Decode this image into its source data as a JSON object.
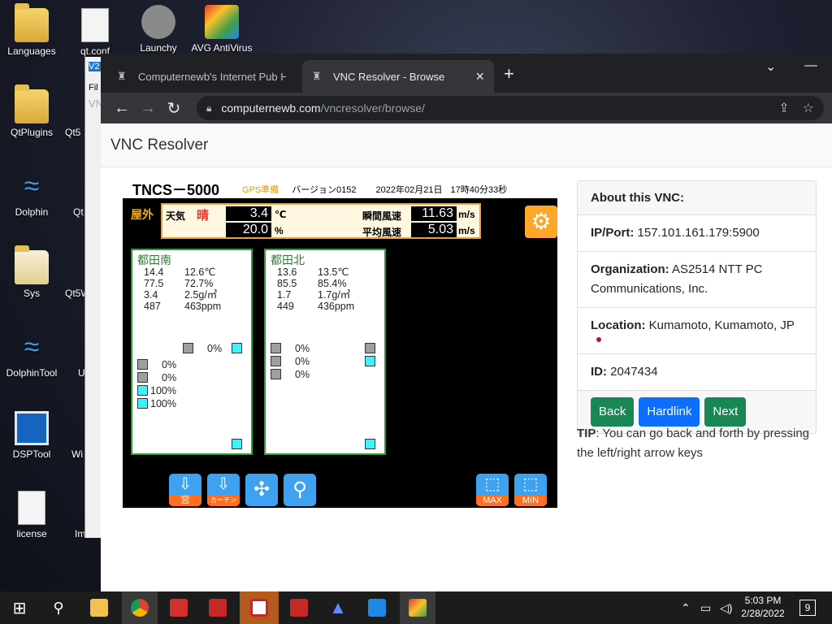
{
  "desktop": {
    "icons": [
      "Languages",
      "qt.conf",
      "Launchy",
      "AVG AntiVirus",
      "QtPlugins",
      "Qt5",
      "Dolphin",
      "Qt",
      "Sys",
      "Qt5W",
      "DolphinTool",
      "U",
      "DSPTool",
      "Wi",
      "license",
      "Im"
    ],
    "partial_window_labels": [
      "V2",
      "Fil",
      "VN"
    ]
  },
  "browser": {
    "tabs": [
      {
        "title": "Computernewb's Internet Pub Hu"
      },
      {
        "title": "VNC Resolver - Browse"
      }
    ],
    "url_host": "computernewb.com",
    "url_path": "/vncresolver/browse/"
  },
  "page": {
    "brand": "VNC Resolver",
    "vnc_screen": {
      "model": "TNCS－5000",
      "gps": "GPS準備",
      "version": "バージョン0152",
      "date": "2022年02月21日",
      "time": "17時40分33秒",
      "outdoor": "屋外",
      "weather_label": "天気",
      "weather_value": "晴",
      "temp": "3.4",
      "temp_unit": "℃",
      "humidity": "20.0",
      "humidity_unit": "%",
      "gust_label": "瞬間風速",
      "gust": "11.63",
      "avg_label": "平均風速",
      "avg": "5.03",
      "wind_unit": "m/s",
      "zones": [
        {
          "name": "都田南",
          "rows": [
            [
              "14.4",
              "12.6℃"
            ],
            [
              "77.5",
              "72.7%"
            ],
            [
              "3.4",
              "2.5g/㎥"
            ],
            [
              "487",
              "463ppm"
            ]
          ],
          "top_pct": "0%",
          "side_pcts": [
            "0%",
            "0%",
            "100%",
            "100%"
          ]
        },
        {
          "name": "都田北",
          "rows": [
            [
              "13.6",
              "13.5℃"
            ],
            [
              "85.5",
              "85.4%"
            ],
            [
              "1.7",
              "1.7g/㎥"
            ],
            [
              "449",
              "436ppm"
            ]
          ],
          "side_pcts": [
            "0%",
            "0%",
            "0%"
          ]
        }
      ],
      "bottom_buttons": [
        "窓",
        "カーテン",
        "MAX",
        "MIN"
      ]
    },
    "card": {
      "header": "About this VNC:",
      "ip_label": "IP/Port:",
      "ip_value": "157.101.161.179:5900",
      "org_label": "Organization:",
      "org_value": "AS2514 NTT PC Communications, Inc.",
      "loc_label": "Location:",
      "loc_value": "Kumamoto, Kumamoto, JP",
      "id_label": "ID:",
      "id_value": "2047434",
      "buttons": {
        "back": "Back",
        "hardlink": "Hardlink",
        "next": "Next"
      }
    },
    "tip": {
      "label": "TIP",
      "text": ": You can go back and forth by pressing the left/right arrow keys"
    }
  },
  "taskbar": {
    "time": "5:03 PM",
    "date": "2/28/2022",
    "notifications": "9"
  }
}
